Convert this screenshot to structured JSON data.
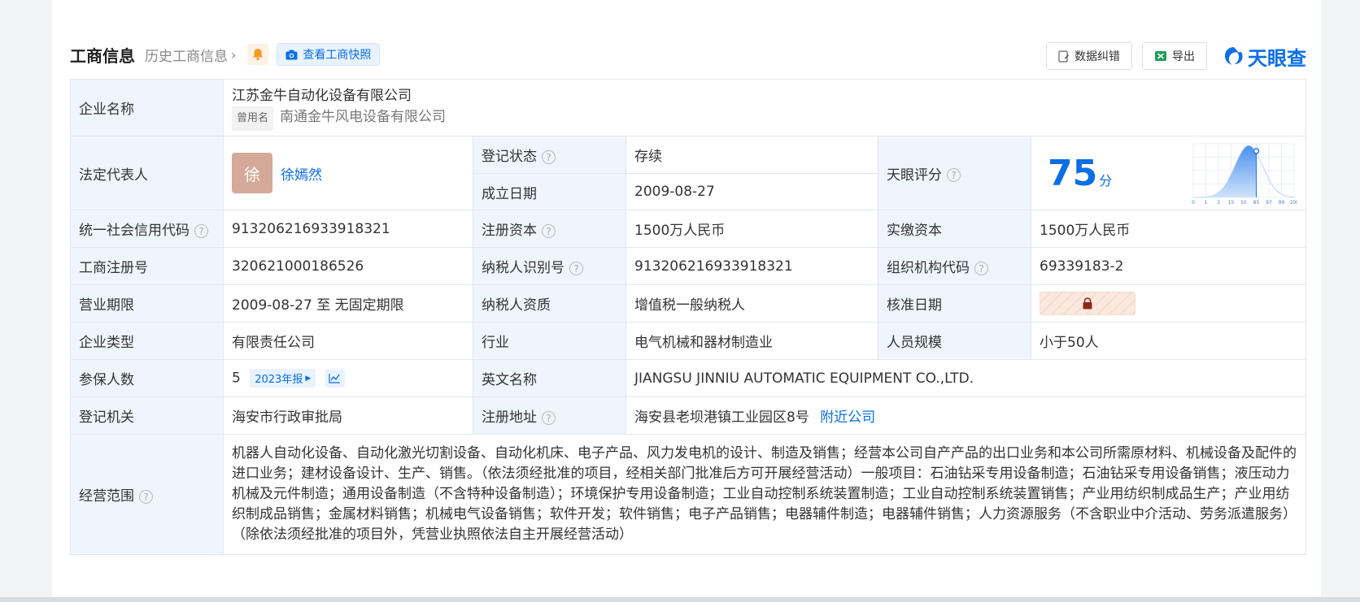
{
  "header": {
    "title": "工商信息",
    "history_link": "历史工商信息",
    "snapshot_button": "查看工商快照",
    "correction_button": "数据纠错",
    "export_button": "导出",
    "brand": "天眼查"
  },
  "company": {
    "name_label": "企业名称",
    "name": "江苏金牛自动化设备有限公司",
    "former_tag": "曾用名",
    "former_name": "南通金牛风电设备有限公司"
  },
  "legal_rep": {
    "label": "法定代表人",
    "avatar_char": "徐",
    "name": "徐嫣然"
  },
  "registration": {
    "status_label": "登记状态",
    "status": "存续",
    "founded_label": "成立日期",
    "founded": "2009-08-27"
  },
  "score": {
    "label": "天眼评分",
    "value": "75",
    "unit": "分",
    "axis_ticks": [
      "0",
      "1",
      "3",
      "15",
      "50",
      "85",
      "97",
      "99",
      "100"
    ],
    "percentile_marker": 85
  },
  "rows": {
    "credit_code_label": "统一社会信用代码",
    "credit_code": "913206216933918321",
    "reg_capital_label": "注册资本",
    "reg_capital": "1500万人民币",
    "paid_capital_label": "实缴资本",
    "paid_capital": "1500万人民币",
    "reg_no_label": "工商注册号",
    "reg_no": "320621000186526",
    "taxpayer_id_label": "纳税人识别号",
    "taxpayer_id": "913206216933918321",
    "org_code_label": "组织机构代码",
    "org_code": "69339183-2",
    "term_label": "营业期限",
    "term": "2009-08-27 至 无固定期限",
    "tax_qual_label": "纳税人资质",
    "tax_qual": "增值税一般纳税人",
    "approve_label": "核准日期",
    "type_label": "企业类型",
    "type": "有限责任公司",
    "industry_label": "行业",
    "industry": "电气机械和器材制造业",
    "staff_label": "人员规模",
    "staff": "小于50人",
    "insured_label": "参保人数",
    "insured": "5",
    "insured_year": "2023年报",
    "english_label": "英文名称",
    "english": "JIANGSU JINNIU AUTOMATIC EQUIPMENT CO.,LTD.",
    "authority_label": "登记机关",
    "authority": "海安市行政审批局",
    "address_label": "注册地址",
    "address": "海安县老坝港镇工业园区8号",
    "nearby_link": "附近公司",
    "scope_label": "经营范围",
    "scope": "机器人自动化设备、自动化激光切割设备、自动化机床、电子产品、风力发电机的设计、制造及销售；经营本公司自产产品的出口业务和本公司所需原材料、机械设备及配件的进口业务；建材设备设计、生产、销售。（依法须经批准的项目，经相关部门批准后方可开展经营活动）一般项目：石油钻采专用设备制造；石油钻采专用设备销售；液压动力机械及元件制造；通用设备制造（不含特种设备制造）；环境保护专用设备制造；工业自动控制系统装置制造；工业自动控制系统装置销售；产业用纺织制成品生产；产业用纺织制成品销售；金属材料销售；机械电气设备销售；软件开发；软件销售；电子产品销售；电器辅件制造；电器辅件销售；人力资源服务（不含职业中介活动、劳务派遣服务）（除依法须经批准的项目外，凭营业执照依法自主开展经营活动）"
  },
  "colors": {
    "accent": "#0a6ee6",
    "label_bg": "#eef5fd",
    "status_green": "#0ea03c"
  }
}
